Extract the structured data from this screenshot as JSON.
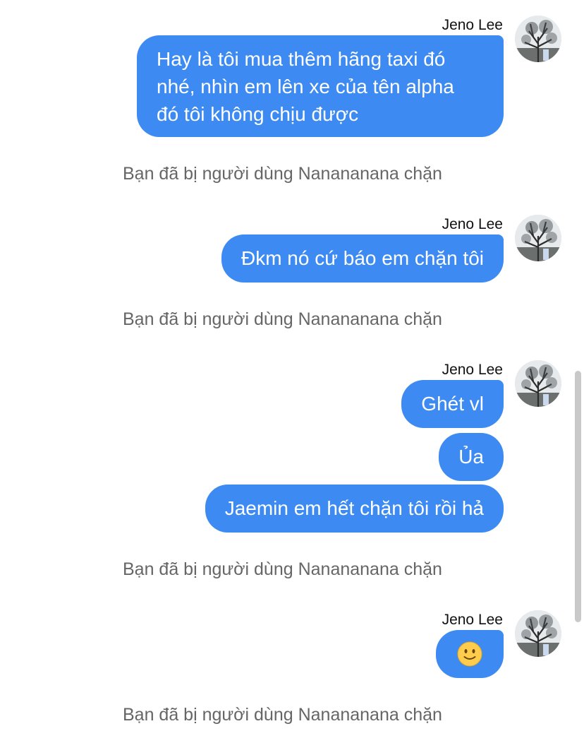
{
  "chat": {
    "sender_name": "Jeno Lee",
    "accent_color": "#3d8af2",
    "blocked_notice": "Bạn đã bị người dùng Nanananana chặn",
    "messages": [
      {
        "text": "Hay là tôi mua thêm hãng taxi đó nhé, nhìn em lên xe của tên alpha đó tôi không chịu được"
      },
      {
        "text": "Đkm nó cứ báo em chặn tôi"
      },
      {
        "text": "Ghét vl"
      },
      {
        "text": "Ủa"
      },
      {
        "text": "Jaemin em hết chặn tôi rồi hả"
      },
      {
        "text": "",
        "icon": "slightly-smiling-face-emoji"
      }
    ]
  }
}
